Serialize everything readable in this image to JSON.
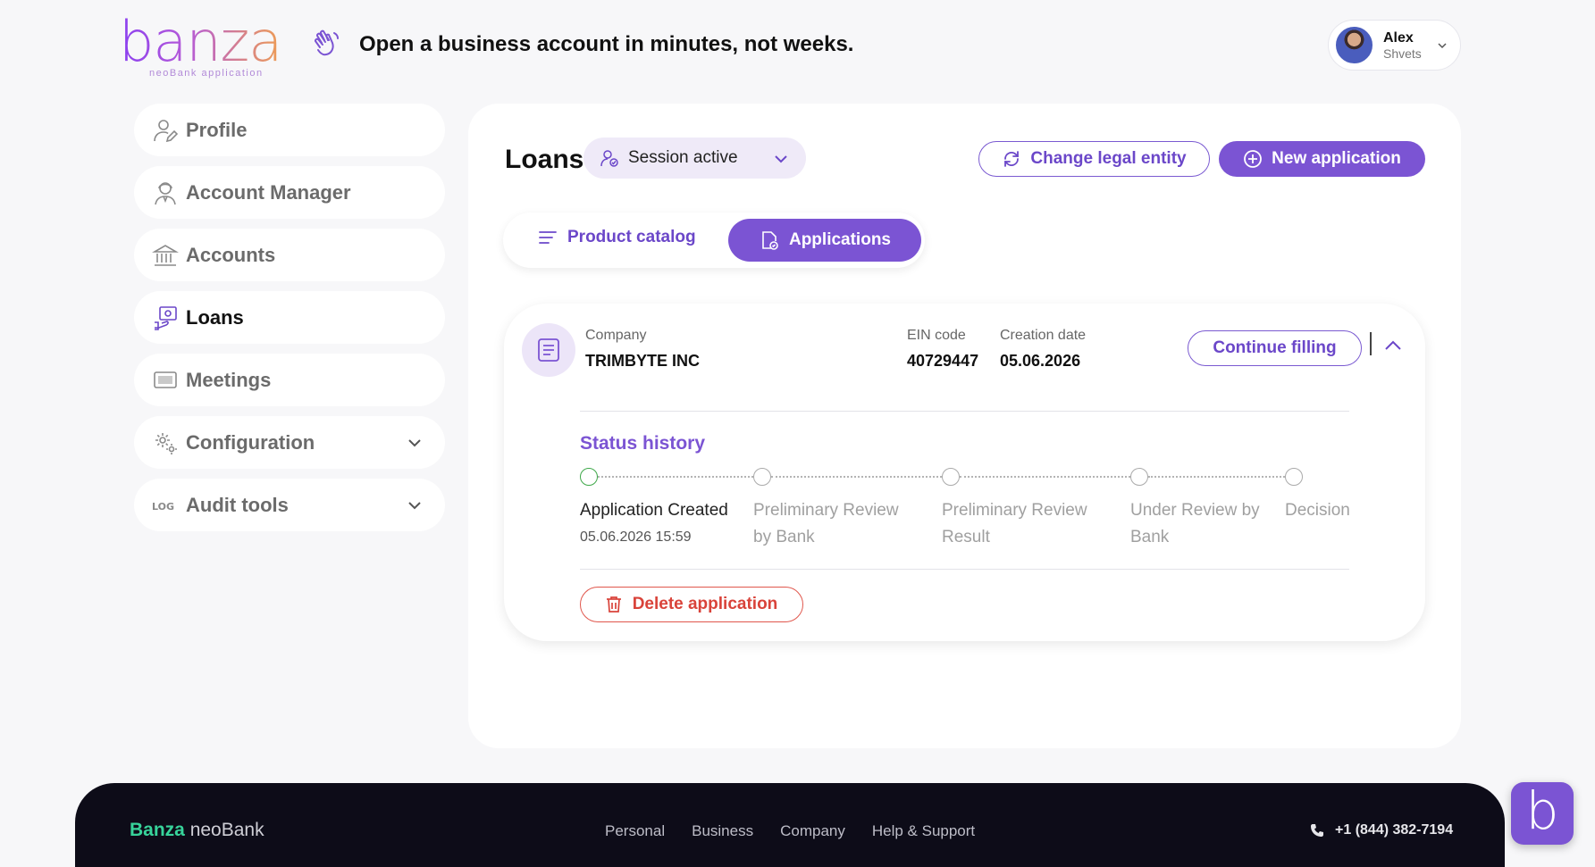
{
  "header": {
    "logo": "banza",
    "logo_sub": "neoBank application",
    "tagline": "Open a business account in minutes, not weeks.",
    "user": {
      "first_name": "Alex",
      "last_name": "Shvets"
    }
  },
  "sidebar": {
    "items": [
      {
        "label": "Profile",
        "icon": "user-edit-icon"
      },
      {
        "label": "Account Manager",
        "icon": "manager-icon"
      },
      {
        "label": "Accounts",
        "icon": "bank-icon"
      },
      {
        "label": "Loans",
        "icon": "loan-icon",
        "active": true
      },
      {
        "label": "Meetings",
        "icon": "meetings-icon"
      },
      {
        "label": "Configuration",
        "icon": "gear-icon",
        "expandable": true
      },
      {
        "label": "Audit tools",
        "icon": "log-icon",
        "expandable": true
      }
    ],
    "audit_icon_text": "LOG"
  },
  "main": {
    "title": "Loans",
    "session_label": "Session active",
    "change_entity_label": "Change legal entity",
    "new_application_label": "New application",
    "tabs": [
      {
        "label": "Product catalog",
        "active": false
      },
      {
        "label": "Applications",
        "active": true
      }
    ]
  },
  "application": {
    "company_label": "Company",
    "company_value": "TRIMBYTE INC",
    "ein_label": "EIN code",
    "ein_value": "40729447",
    "creation_label": "Creation date",
    "creation_value": "05.06.2026",
    "continue_label": "Continue filling",
    "status_title": "Status history",
    "steps": [
      {
        "label": "Application Created",
        "time": "05.06.2026 15:59",
        "done": true
      },
      {
        "label": "Preliminary Review by Bank",
        "done": false
      },
      {
        "label": "Preliminary Review Result",
        "done": false
      },
      {
        "label": "Under Review by Bank",
        "done": false
      },
      {
        "label": "Decision",
        "done": false
      }
    ],
    "delete_label": "Delete application"
  },
  "footer": {
    "brand_bold": "Banza",
    "brand_rest": "neoBank",
    "links": [
      "Personal",
      "Business",
      "Company",
      "Help & Support"
    ],
    "phone": "+1 (844) 382-7194"
  },
  "chat": {
    "glyph": "b"
  },
  "colors": {
    "accent": "#7b54d3",
    "danger": "#d9433a",
    "success": "#3fa84a",
    "footer_bg": "#0d0c18"
  }
}
